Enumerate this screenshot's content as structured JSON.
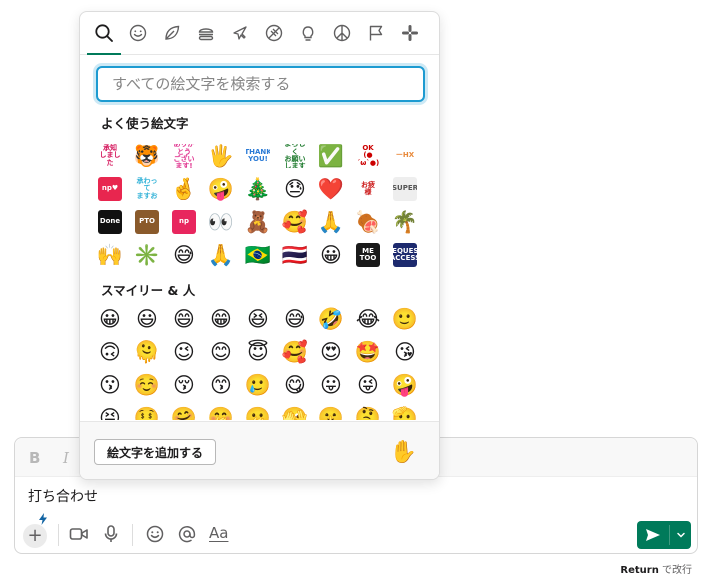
{
  "picker": {
    "tabs": [
      {
        "icon": "search-icon",
        "label": "検索"
      },
      {
        "icon": "smiley-icon",
        "label": "スマイリー"
      },
      {
        "icon": "leaf-icon",
        "label": "自然"
      },
      {
        "icon": "burger-icon",
        "label": "食べ物"
      },
      {
        "icon": "plane-icon",
        "label": "旅行"
      },
      {
        "icon": "ball-icon",
        "label": "アクティビティ"
      },
      {
        "icon": "bulb-icon",
        "label": "物"
      },
      {
        "icon": "peace-icon",
        "label": "記号"
      },
      {
        "icon": "flag-icon",
        "label": "旗"
      },
      {
        "icon": "slack-icon",
        "label": "カスタム"
      }
    ],
    "search_placeholder": "すべての絵文字を検索する",
    "frequent_title": "よく使う絵文字",
    "smileys_title": "スマイリー & 人",
    "frequent": [
      {
        "t": "s",
        "text": "承知\nしました",
        "fg": "#d4145a",
        "bg": "#ffffff"
      },
      {
        "t": "e",
        "e": "🐯"
      },
      {
        "t": "s",
        "text": "ありがとう\nございます!",
        "fg": "#e0338f",
        "bg": "#ffffff"
      },
      {
        "t": "e",
        "e": "🖐"
      },
      {
        "t": "s",
        "text": "THANK\nYOU!",
        "fg": "#2b7bd6",
        "bg": "#ffffff"
      },
      {
        "t": "s",
        "text": "よろしく\nお願い\nします",
        "fg": "#1e7a2d",
        "bg": "#ffffff"
      },
      {
        "t": "e",
        "e": "✅"
      },
      {
        "t": "s",
        "text": "OK\n(●´ω`●)",
        "fg": "#cc0000",
        "bg": "#ffffff"
      },
      {
        "t": "s",
        "text": "ーHX",
        "fg": "#e8893a",
        "bg": "#ffffff"
      },
      {
        "t": "s",
        "text": "np♥",
        "fg": "#ffffff",
        "bg": "#e8264f"
      },
      {
        "t": "s",
        "text": "承わって\nますお",
        "fg": "#35b3d8",
        "bg": "#ffffff"
      },
      {
        "t": "e",
        "e": "🤞"
      },
      {
        "t": "e",
        "e": "🤪"
      },
      {
        "t": "e",
        "e": "🎄"
      },
      {
        "t": "e",
        "e": "😓"
      },
      {
        "t": "e",
        "e": "❤️"
      },
      {
        "t": "s",
        "text": "お疲\n様",
        "fg": "#cc1a1a",
        "bg": "#ffffff"
      },
      {
        "t": "s",
        "text": "SUPER",
        "fg": "#555555",
        "bg": "#eeeeee"
      },
      {
        "t": "s",
        "text": "Done",
        "fg": "#ffffff",
        "bg": "#111111"
      },
      {
        "t": "s",
        "text": "PTO",
        "fg": "#ffffff",
        "bg": "#8a5a2b"
      },
      {
        "t": "s",
        "text": "np",
        "fg": "#ffffff",
        "bg": "#e8265e"
      },
      {
        "t": "e",
        "e": "👀"
      },
      {
        "t": "e",
        "e": "🧸"
      },
      {
        "t": "e",
        "e": "🥰"
      },
      {
        "t": "e",
        "e": "🙏"
      },
      {
        "t": "e",
        "e": "🍖"
      },
      {
        "t": "e",
        "e": "🌴"
      },
      {
        "t": "e",
        "e": "🙌"
      },
      {
        "t": "e",
        "e": "✳️"
      },
      {
        "t": "e",
        "e": "😅"
      },
      {
        "t": "e",
        "e": "🙏"
      },
      {
        "t": "e",
        "e": "🇧🇷"
      },
      {
        "t": "e",
        "e": "🇹🇭"
      },
      {
        "t": "e",
        "e": "😀"
      },
      {
        "t": "s",
        "text": "ME\nTOO",
        "fg": "#ffffff",
        "bg": "#1a1a1a"
      },
      {
        "t": "s",
        "text": "REQUEST\nACCESS",
        "fg": "#ffffff",
        "bg": "#1d2a6e"
      }
    ],
    "smileys": [
      "😀",
      "😃",
      "😄",
      "😁",
      "😆",
      "😅",
      "🤣",
      "😂",
      "🙂",
      "🙃",
      "🫠",
      "😉",
      "😊",
      "😇",
      "🥰",
      "😍",
      "🤩",
      "😘",
      "😗",
      "☺️",
      "😚",
      "😙",
      "🥲",
      "😋",
      "😛",
      "😜",
      "🤪",
      "😝",
      "🤑",
      "🤗",
      "🤭",
      "🫢",
      "🫣",
      "🤫",
      "🤔",
      "🫡"
    ],
    "add_emoji_label": "絵文字を追加する",
    "skin_tone": "✋"
  },
  "composer": {
    "bold_label": "B",
    "italic_label": "I",
    "message": "打ち合わせ",
    "aa_label": "Aa",
    "hint_key": "Return",
    "hint_text": " で改行"
  }
}
